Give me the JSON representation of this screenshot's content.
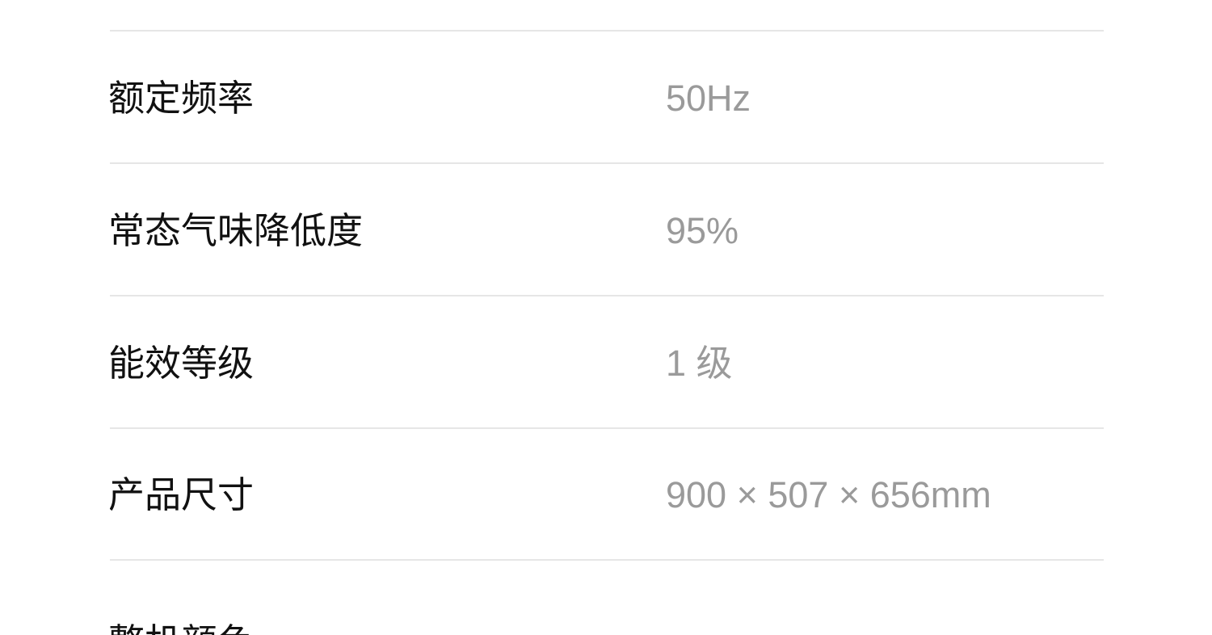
{
  "spec_rows": [
    {
      "label": "额定频率",
      "value": "50Hz"
    },
    {
      "label": "常态气味降低度",
      "value": "95%"
    },
    {
      "label": "能效等级",
      "value": "1 级"
    },
    {
      "label": "产品尺寸",
      "value": "900 × 507 × 656mm"
    },
    {
      "label": "整机颜色",
      "value": ""
    }
  ]
}
